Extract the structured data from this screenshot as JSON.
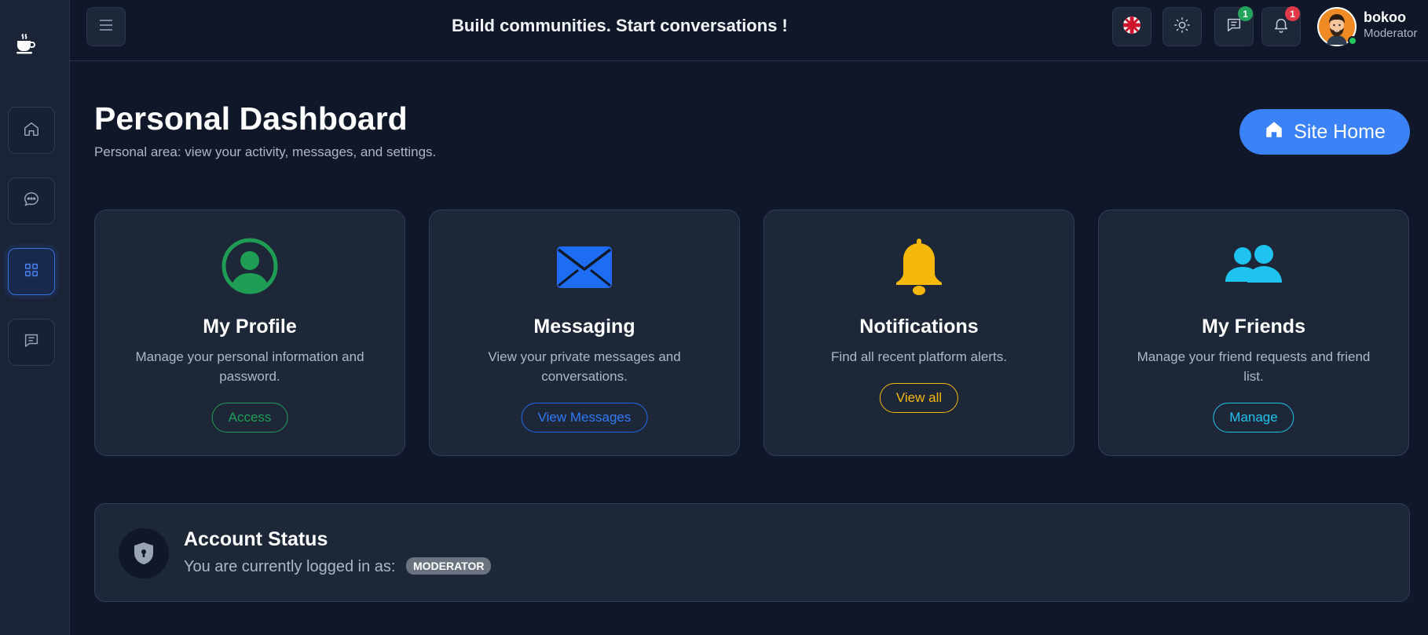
{
  "header": {
    "tagline": "Build communities. Start conversations !",
    "user": {
      "name": "bokoo",
      "role": "Moderator"
    },
    "badges": {
      "messages": "1",
      "notifications": "1"
    }
  },
  "sidebar": {
    "items": [
      {
        "icon": "home-icon"
      },
      {
        "icon": "chat-bubble-icon"
      },
      {
        "icon": "dashboard-grid-icon",
        "active": true
      },
      {
        "icon": "message-square-icon"
      }
    ]
  },
  "page": {
    "title": "Personal Dashboard",
    "subtitle": "Personal area: view your activity, messages, and settings.",
    "site_home_label": "Site Home"
  },
  "cards": [
    {
      "title": "My Profile",
      "description": "Manage your personal information and password.",
      "button": "Access",
      "icon": "user-circle-icon",
      "color": "#1f9d55"
    },
    {
      "title": "Messaging",
      "description": "View your private messages and conversations.",
      "button": "View Messages",
      "icon": "envelope-icon",
      "color": "#1d6cf2"
    },
    {
      "title": "Notifications",
      "description": "Find all recent platform alerts.",
      "button": "View all",
      "icon": "bell-icon",
      "color": "#f5b80b"
    },
    {
      "title": "My Friends",
      "description": "Manage your friend requests and friend list.",
      "button": "Manage",
      "icon": "users-icon",
      "color": "#1ec3f0"
    }
  ],
  "account_status": {
    "title": "Account Status",
    "text": "You are currently logged in as:",
    "role_badge": "MODERATOR"
  }
}
